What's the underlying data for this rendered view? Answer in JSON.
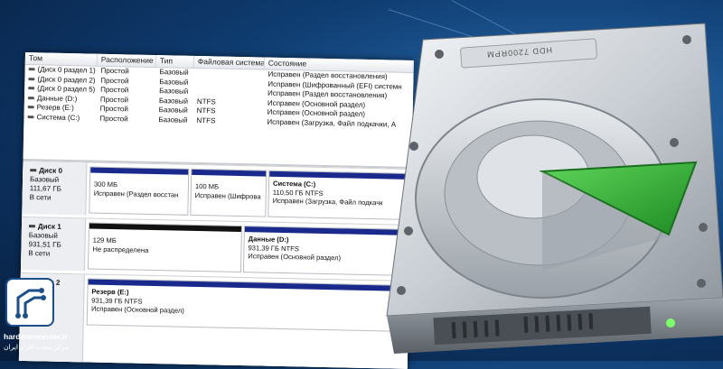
{
  "volume_table": {
    "columns": [
      "Том",
      "Расположение",
      "Тип",
      "Файловая система",
      "Состояние"
    ],
    "rows": [
      [
        "(Диск 0 раздел 1)",
        "Простой",
        "Базовый",
        "",
        "Исправен (Раздел восстановления)"
      ],
      [
        "(Диск 0 раздел 2)",
        "Простой",
        "Базовый",
        "",
        "Исправен (Шифрованный (EFI) системн"
      ],
      [
        "(Диск 0 раздел 5)",
        "Простой",
        "Базовый",
        "",
        "Исправен (Раздел восстановления)"
      ],
      [
        "Данные (D:)",
        "Простой",
        "Базовый",
        "NTFS",
        "Исправен (Основной раздел)"
      ],
      [
        "Резерв (E:)",
        "Простой",
        "Базовый",
        "NTFS",
        "Исправен (Основной раздел)"
      ],
      [
        "Система (C:)",
        "Простой",
        "Базовый",
        "NTFS",
        "Исправен (Загрузка, Файл подкачки, А"
      ]
    ]
  },
  "disks": [
    {
      "name": "Диск 0",
      "type": "Базовый",
      "size": "111,67 ГБ",
      "status": "В сети",
      "partitions": [
        {
          "title": "",
          "size": "300 МБ",
          "state": "Исправен (Раздел восстан",
          "bar": "blue"
        },
        {
          "title": "",
          "size": "100 МБ",
          "state": "Исправен (Шифрова",
          "bar": "blue"
        },
        {
          "title": "Система  (C:)",
          "size": "110,50 ГБ NTFS",
          "state": "Исправен (Загрузка, Файл подкачк",
          "bar": "blue"
        }
      ]
    },
    {
      "name": "Диск 1",
      "type": "Базовый",
      "size": "931,51 ГБ",
      "status": "В сети",
      "partitions": [
        {
          "title": "",
          "size": "129 МБ",
          "state": "Не распределена",
          "bar": "black"
        },
        {
          "title": "Данные  (D:)",
          "size": "931,39 ГБ NTFS",
          "state": "Исправен (Основной раздел)",
          "bar": "blue"
        }
      ]
    },
    {
      "name": "Диск 2",
      "type": "",
      "size": "",
      "status": "",
      "partitions": [
        {
          "title": "Резерв  (E:)",
          "size": "931,39 ГБ NTFS",
          "state": "Исправен (Основной раздел)",
          "bar": "blue"
        }
      ]
    }
  ],
  "hdd_label": "HDD 7200RPM",
  "logo": {
    "domain": "hardwarecenter.ir",
    "subtitle": "مرکز سخت افزار ایران"
  },
  "colors": {
    "partition_bar": "#1a2a8c",
    "unallocated_bar": "#111111",
    "platter_slice": "#2fa82f",
    "background": "#0f3d72"
  }
}
